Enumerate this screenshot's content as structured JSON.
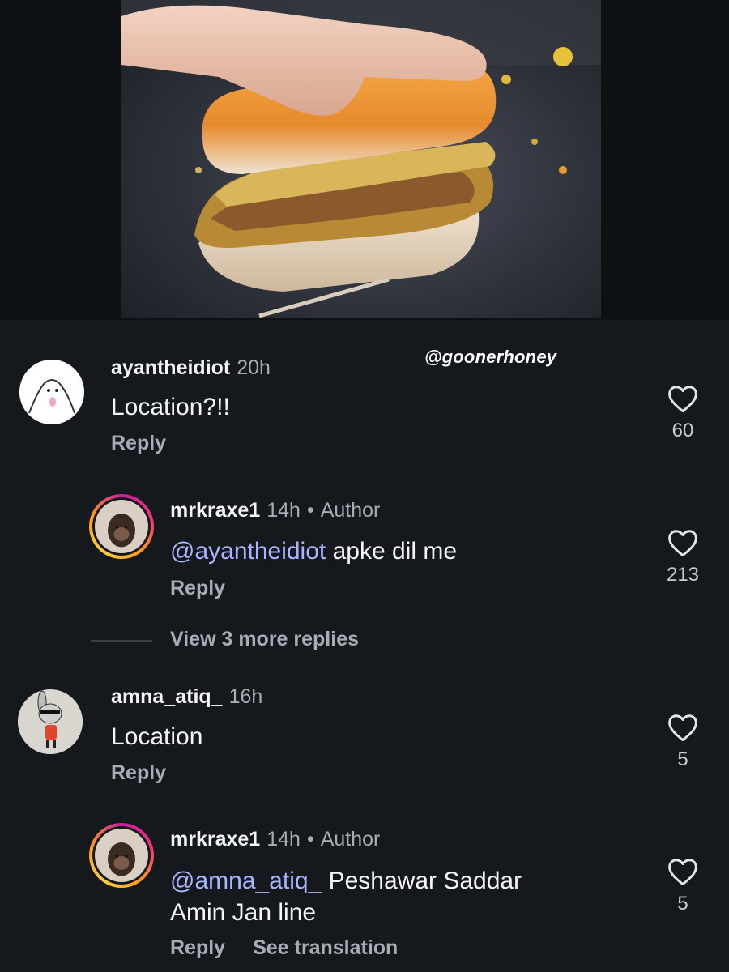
{
  "watermark": "@goonerhoney",
  "comments": [
    {
      "user": "ayantheidiot",
      "time": "20h",
      "text": "Location?!!",
      "reply_label": "Reply",
      "likes": "60"
    },
    {
      "user": "mrkraxe1",
      "time": "14h",
      "author_tag": "Author",
      "mention": "@ayantheidiot",
      "text": "apke dil me",
      "reply_label": "Reply",
      "likes": "213"
    },
    {
      "user": "amna_atiq_",
      "time": "16h",
      "text": "Location",
      "reply_label": "Reply",
      "likes": "5"
    },
    {
      "user": "mrkraxe1",
      "time": "14h",
      "author_tag": "Author",
      "mention": "@amna_atiq_",
      "text_line1": "Peshawar Saddar",
      "text_line2": "Amin Jan line",
      "reply_label": "Reply",
      "translate_label": "See translation",
      "likes": "5"
    }
  ],
  "view_more_replies": "View 3 more replies",
  "icons": {
    "like": "heart-outline-icon"
  }
}
